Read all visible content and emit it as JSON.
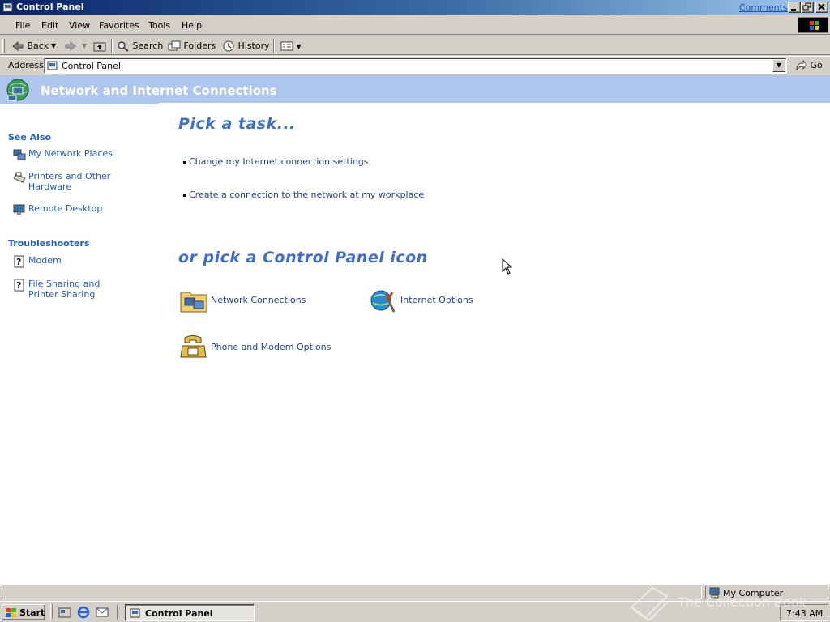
{
  "window": {
    "title": "Control Panel",
    "comments_link": "Comments?",
    "caption_buttons": [
      "minimize",
      "maximize",
      "close"
    ]
  },
  "menu": {
    "items": [
      "File",
      "Edit",
      "View",
      "Favorites",
      "Tools",
      "Help"
    ]
  },
  "toolbar": {
    "back": "Back",
    "search": "Search",
    "folders": "Folders",
    "history": "History"
  },
  "address": {
    "label": "Address",
    "value": "Control Panel",
    "go": "Go"
  },
  "banner": {
    "title": "Network and Internet Connections"
  },
  "sidebar": {
    "see_also": {
      "heading": "See Also",
      "items": [
        "My Network Places",
        "Printers and Other Hardware",
        "Remote Desktop"
      ]
    },
    "troubleshooters": {
      "heading": "Troubleshooters",
      "items": [
        "Modem",
        "File Sharing and Printer Sharing"
      ]
    }
  },
  "main": {
    "pick_task": "Pick a task...",
    "tasks": [
      "Change my Internet connection settings",
      "Create a connection to the network at my workplace"
    ],
    "pick_icon": "or pick a Control Panel icon",
    "icons": [
      "Network Connections",
      "Internet Options",
      "Phone and Modem Options"
    ]
  },
  "statusbar": {
    "zone": "My Computer"
  },
  "taskbar": {
    "start": "Start",
    "task_button": "Control Panel",
    "clock": "7:43 AM",
    "watermark": "The Collection Book"
  },
  "colors": {
    "title_gradient_start": "#0a246a",
    "banner": "#aec6ee",
    "link": "#215dc6",
    "heading": "#3f6fc6"
  }
}
